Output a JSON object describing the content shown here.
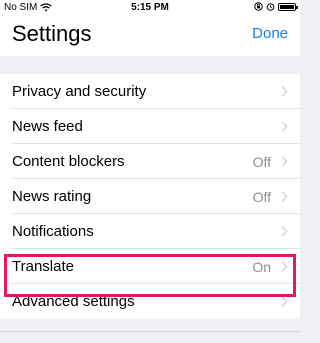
{
  "status_bar": {
    "carrier": "No SIM",
    "time": "5:15 PM"
  },
  "nav": {
    "title": "Settings",
    "done_label": "Done"
  },
  "settings": {
    "items": [
      {
        "label": "Privacy and security",
        "value": ""
      },
      {
        "label": "News feed",
        "value": ""
      },
      {
        "label": "Content blockers",
        "value": "Off"
      },
      {
        "label": "News rating",
        "value": "Off"
      },
      {
        "label": "Notifications",
        "value": ""
      },
      {
        "label": "Translate",
        "value": "On"
      },
      {
        "label": "Advanced settings",
        "value": ""
      }
    ]
  },
  "colors": {
    "accent": "#1a7fe0",
    "highlight_border": "#e8185b",
    "background": "#efeff4"
  },
  "icons": [
    "wifi-icon",
    "screen-lock-icon",
    "alarm-icon",
    "battery-icon",
    "chevron-right-icon"
  ]
}
